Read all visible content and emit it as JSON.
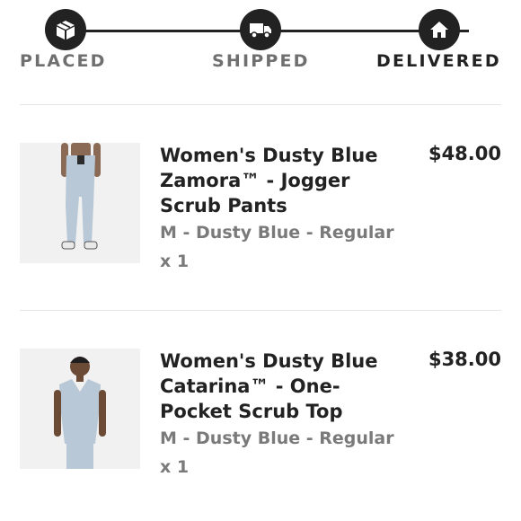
{
  "tracker": {
    "steps": [
      {
        "label": "PLACED",
        "icon": "box-icon"
      },
      {
        "label": "SHIPPED",
        "icon": "truck-icon"
      },
      {
        "label": "DELIVERED",
        "icon": "home-icon"
      }
    ],
    "current_step": "DELIVERED"
  },
  "items": [
    {
      "title": "Women's Dusty Blue Zamora™ - Jogger Scrub Pants",
      "price": "$48.00",
      "variant": "M - Dusty Blue - Regular",
      "quantity": "x 1",
      "image": "jogger-scrub-pants-photo"
    },
    {
      "title": "Women's Dusty Blue Catarina™ - One-Pocket Scrub Top",
      "price": "$38.00",
      "variant": "M - Dusty Blue - Regular",
      "quantity": "x 1",
      "image": "scrub-top-photo"
    }
  ],
  "colors": {
    "dark": "#222222",
    "muted": "#7a7a7a",
    "dusty_blue": "#b9c8d6"
  }
}
